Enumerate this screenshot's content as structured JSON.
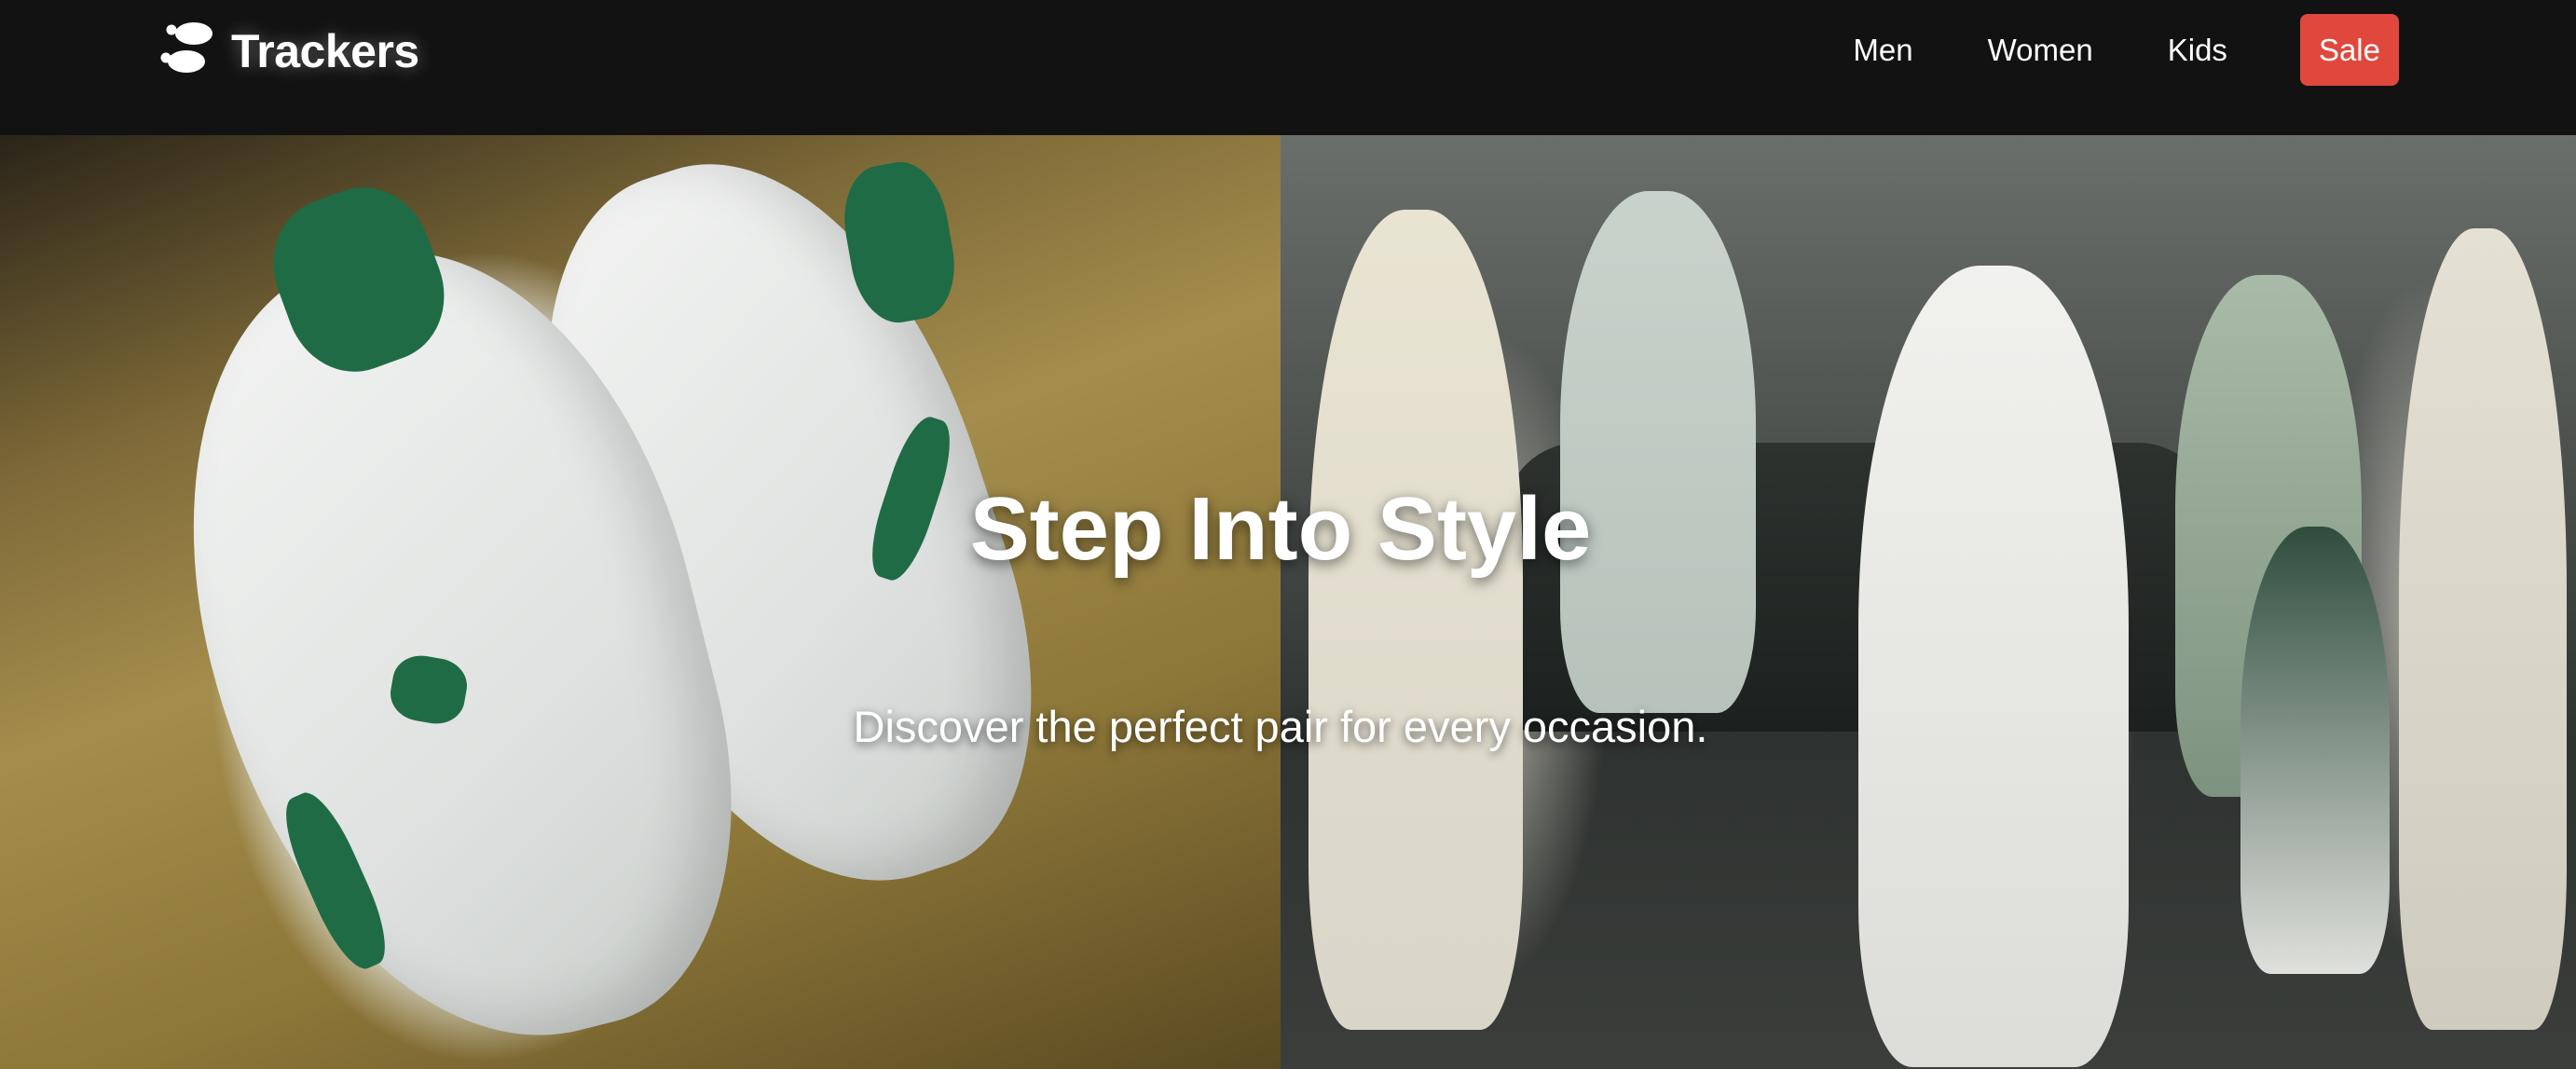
{
  "header": {
    "logo_text": "Trackers",
    "logo_icon": "footprints-icon",
    "nav": [
      {
        "label": "Men"
      },
      {
        "label": "Women"
      },
      {
        "label": "Kids"
      },
      {
        "label": "Sale"
      }
    ]
  },
  "hero": {
    "title": "Step Into Style",
    "subtitle": "Discover the perfect pair for every occasion."
  },
  "colors": {
    "nav_background": "#121212",
    "sale_accent": "#e0483e",
    "text": "#ffffff"
  }
}
